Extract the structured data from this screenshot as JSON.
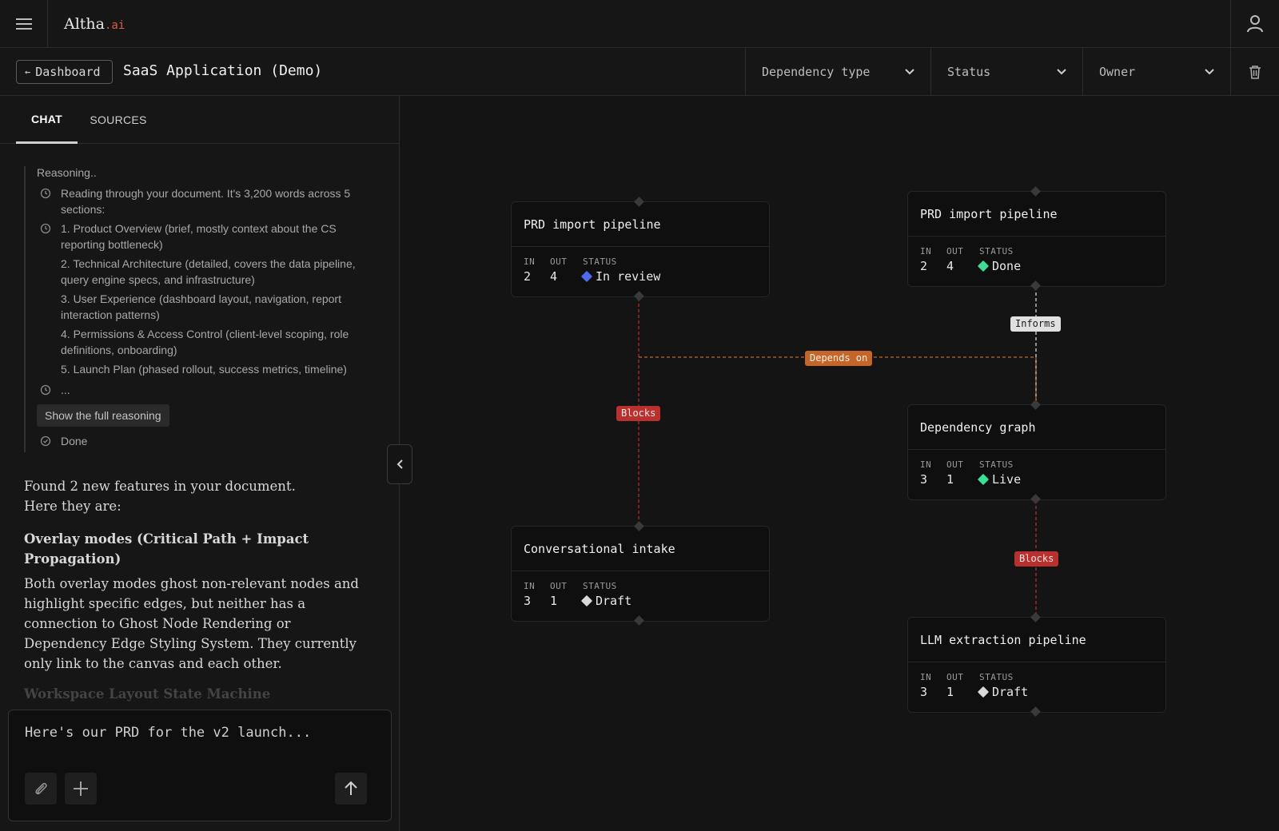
{
  "app": {
    "logo_name": "Altha",
    "logo_suffix": ".ai"
  },
  "header": {
    "back_label": "Dashboard",
    "title": "SaaS Application (Demo)",
    "filters": [
      {
        "label": "Dependency type"
      },
      {
        "label": "Status"
      },
      {
        "label": "Owner"
      }
    ]
  },
  "tabs": [
    {
      "label": "CHAT"
    },
    {
      "label": "SOURCES"
    }
  ],
  "reasoning": {
    "title": "Reasoning..",
    "items": [
      "Reading through your document. It's 3,200 words across 5 sections:",
      "1. Product Overview (brief, mostly context about the CS reporting bottleneck)",
      "2. Technical Architecture (detailed, covers the data pipeline, query engine specs, and infrastructure)",
      "3. User Experience (dashboard layout, navigation, report interaction patterns)",
      "4. Permissions & Access Control (client-level scoping, role definitions, onboarding)",
      "5. Launch Plan (phased rollout, success metrics, timeline)",
      "..."
    ],
    "show_full_label": "Show the full reasoning",
    "done_label": "Done"
  },
  "answer": {
    "intro": "Found 2 new features in your document. Here they are:",
    "feature_title": "Overlay modes (Critical Path + Impact Propagation)",
    "feature_body": "Both overlay modes ghost non-relevant nodes and highlight specific edges, but neither has a connection to Ghost Node Rendering or Dependency Edge Styling System. They currently only link to the canvas and each other.",
    "next_title": "Workspace Layout State Machine"
  },
  "composer": {
    "placeholder": "Here's our PRD for the v2 launch..."
  },
  "meta_labels": {
    "in": "IN",
    "out": "OUT",
    "status": "STATUS"
  },
  "colors": {
    "in_review": "#4f6bed",
    "done": "#3ddc97",
    "live": "#3ddc97",
    "draft": "#d9d9d9",
    "blocks": "#b8312f",
    "depends_on": "#c4662a",
    "informs": "#e0e0e0"
  },
  "nodes": [
    {
      "title": "PRD import pipeline",
      "in": "2",
      "out": "4",
      "status": "In review",
      "status_color": "#4f6bed"
    },
    {
      "title": "PRD import pipeline",
      "in": "2",
      "out": "4",
      "status": "Done",
      "status_color": "#3ddc97"
    },
    {
      "title": "Dependency graph",
      "in": "3",
      "out": "1",
      "status": "Live",
      "status_color": "#3ddc97"
    },
    {
      "title": "Conversational intake",
      "in": "3",
      "out": "1",
      "status": "Draft",
      "status_color": "#d9d9d9"
    },
    {
      "title": "LLM extraction pipeline",
      "in": "3",
      "out": "1",
      "status": "Draft",
      "status_color": "#d9d9d9"
    }
  ],
  "edges": [
    {
      "label": "Blocks",
      "from": "PRD import pipeline",
      "to": "Conversational intake"
    },
    {
      "label": "Depends on",
      "from": "PRD import pipeline",
      "to": "Dependency graph"
    },
    {
      "label": "Informs",
      "from": "PRD import pipeline",
      "to": "Dependency graph"
    },
    {
      "label": "Blocks",
      "from": "Dependency graph",
      "to": "LLM extraction pipeline"
    }
  ]
}
